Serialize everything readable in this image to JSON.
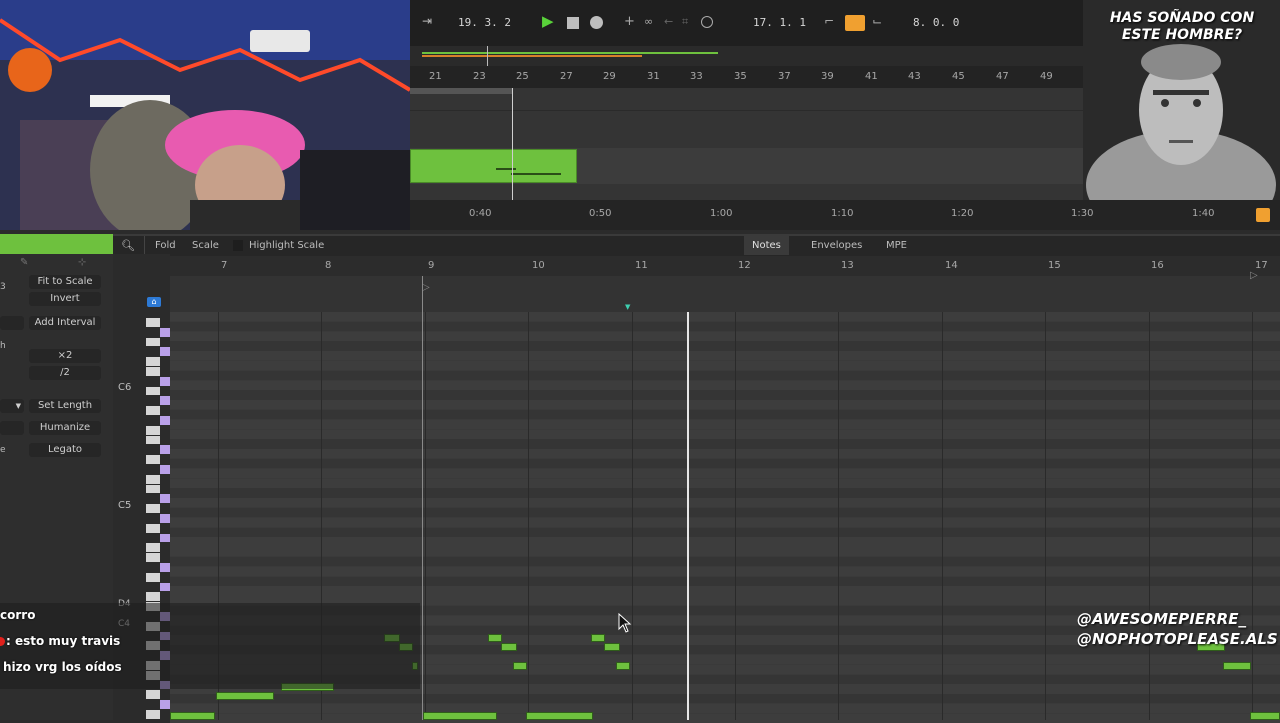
{
  "webcam_right": {
    "caption": "HAS SOÑADO CON ESTE HOMBRE?"
  },
  "transport": {
    "position": "19. 3. 2",
    "loop_start": "17. 1. 1",
    "loop_length": "8. 0. 0"
  },
  "arrangement": {
    "bar_numbers": [
      "21",
      "23",
      "25",
      "27",
      "29",
      "31",
      "33",
      "35",
      "37",
      "39",
      "41",
      "43",
      "45",
      "47",
      "49"
    ],
    "time_labels": [
      "0:40",
      "0:50",
      "1:00",
      "1:10",
      "1:20",
      "1:30",
      "1:40"
    ]
  },
  "editor": {
    "fold": "Fold",
    "scale": "Scale",
    "highlight_scale": "Highlight Scale",
    "tabs": [
      "Notes",
      "Envelopes",
      "MPE"
    ],
    "bar_numbers": [
      "7",
      "8",
      "9",
      "10",
      "11",
      "12",
      "13",
      "14",
      "15",
      "16",
      "17"
    ],
    "tools": {
      "fit_to_scale": "Fit to Scale",
      "invert": "Invert",
      "add_interval": "Add Interval",
      "double": "×2",
      "half": "/2",
      "set_length": "Set Length",
      "humanize": "Humanize",
      "legato": "Legato",
      "frag_1": "3",
      "frag_2": "h",
      "frag_3": "e"
    },
    "key_labels": {
      "c6": "C6",
      "c5": "C5",
      "d4": "D4",
      "c4": "C4"
    }
  },
  "chat": {
    "line1": "corro",
    "line2": ": esto muy travis",
    "line3": "hizo vrg los oídos"
  },
  "credits": {
    "line1": "@AWESOMEPIERRE_",
    "line2": "@NOPHOTOPLEASE.ALS"
  },
  "colors": {
    "accent_green": "#6ec13e",
    "loop_orange": "#f0a030",
    "highlight_purple": "#b9a0e8"
  }
}
